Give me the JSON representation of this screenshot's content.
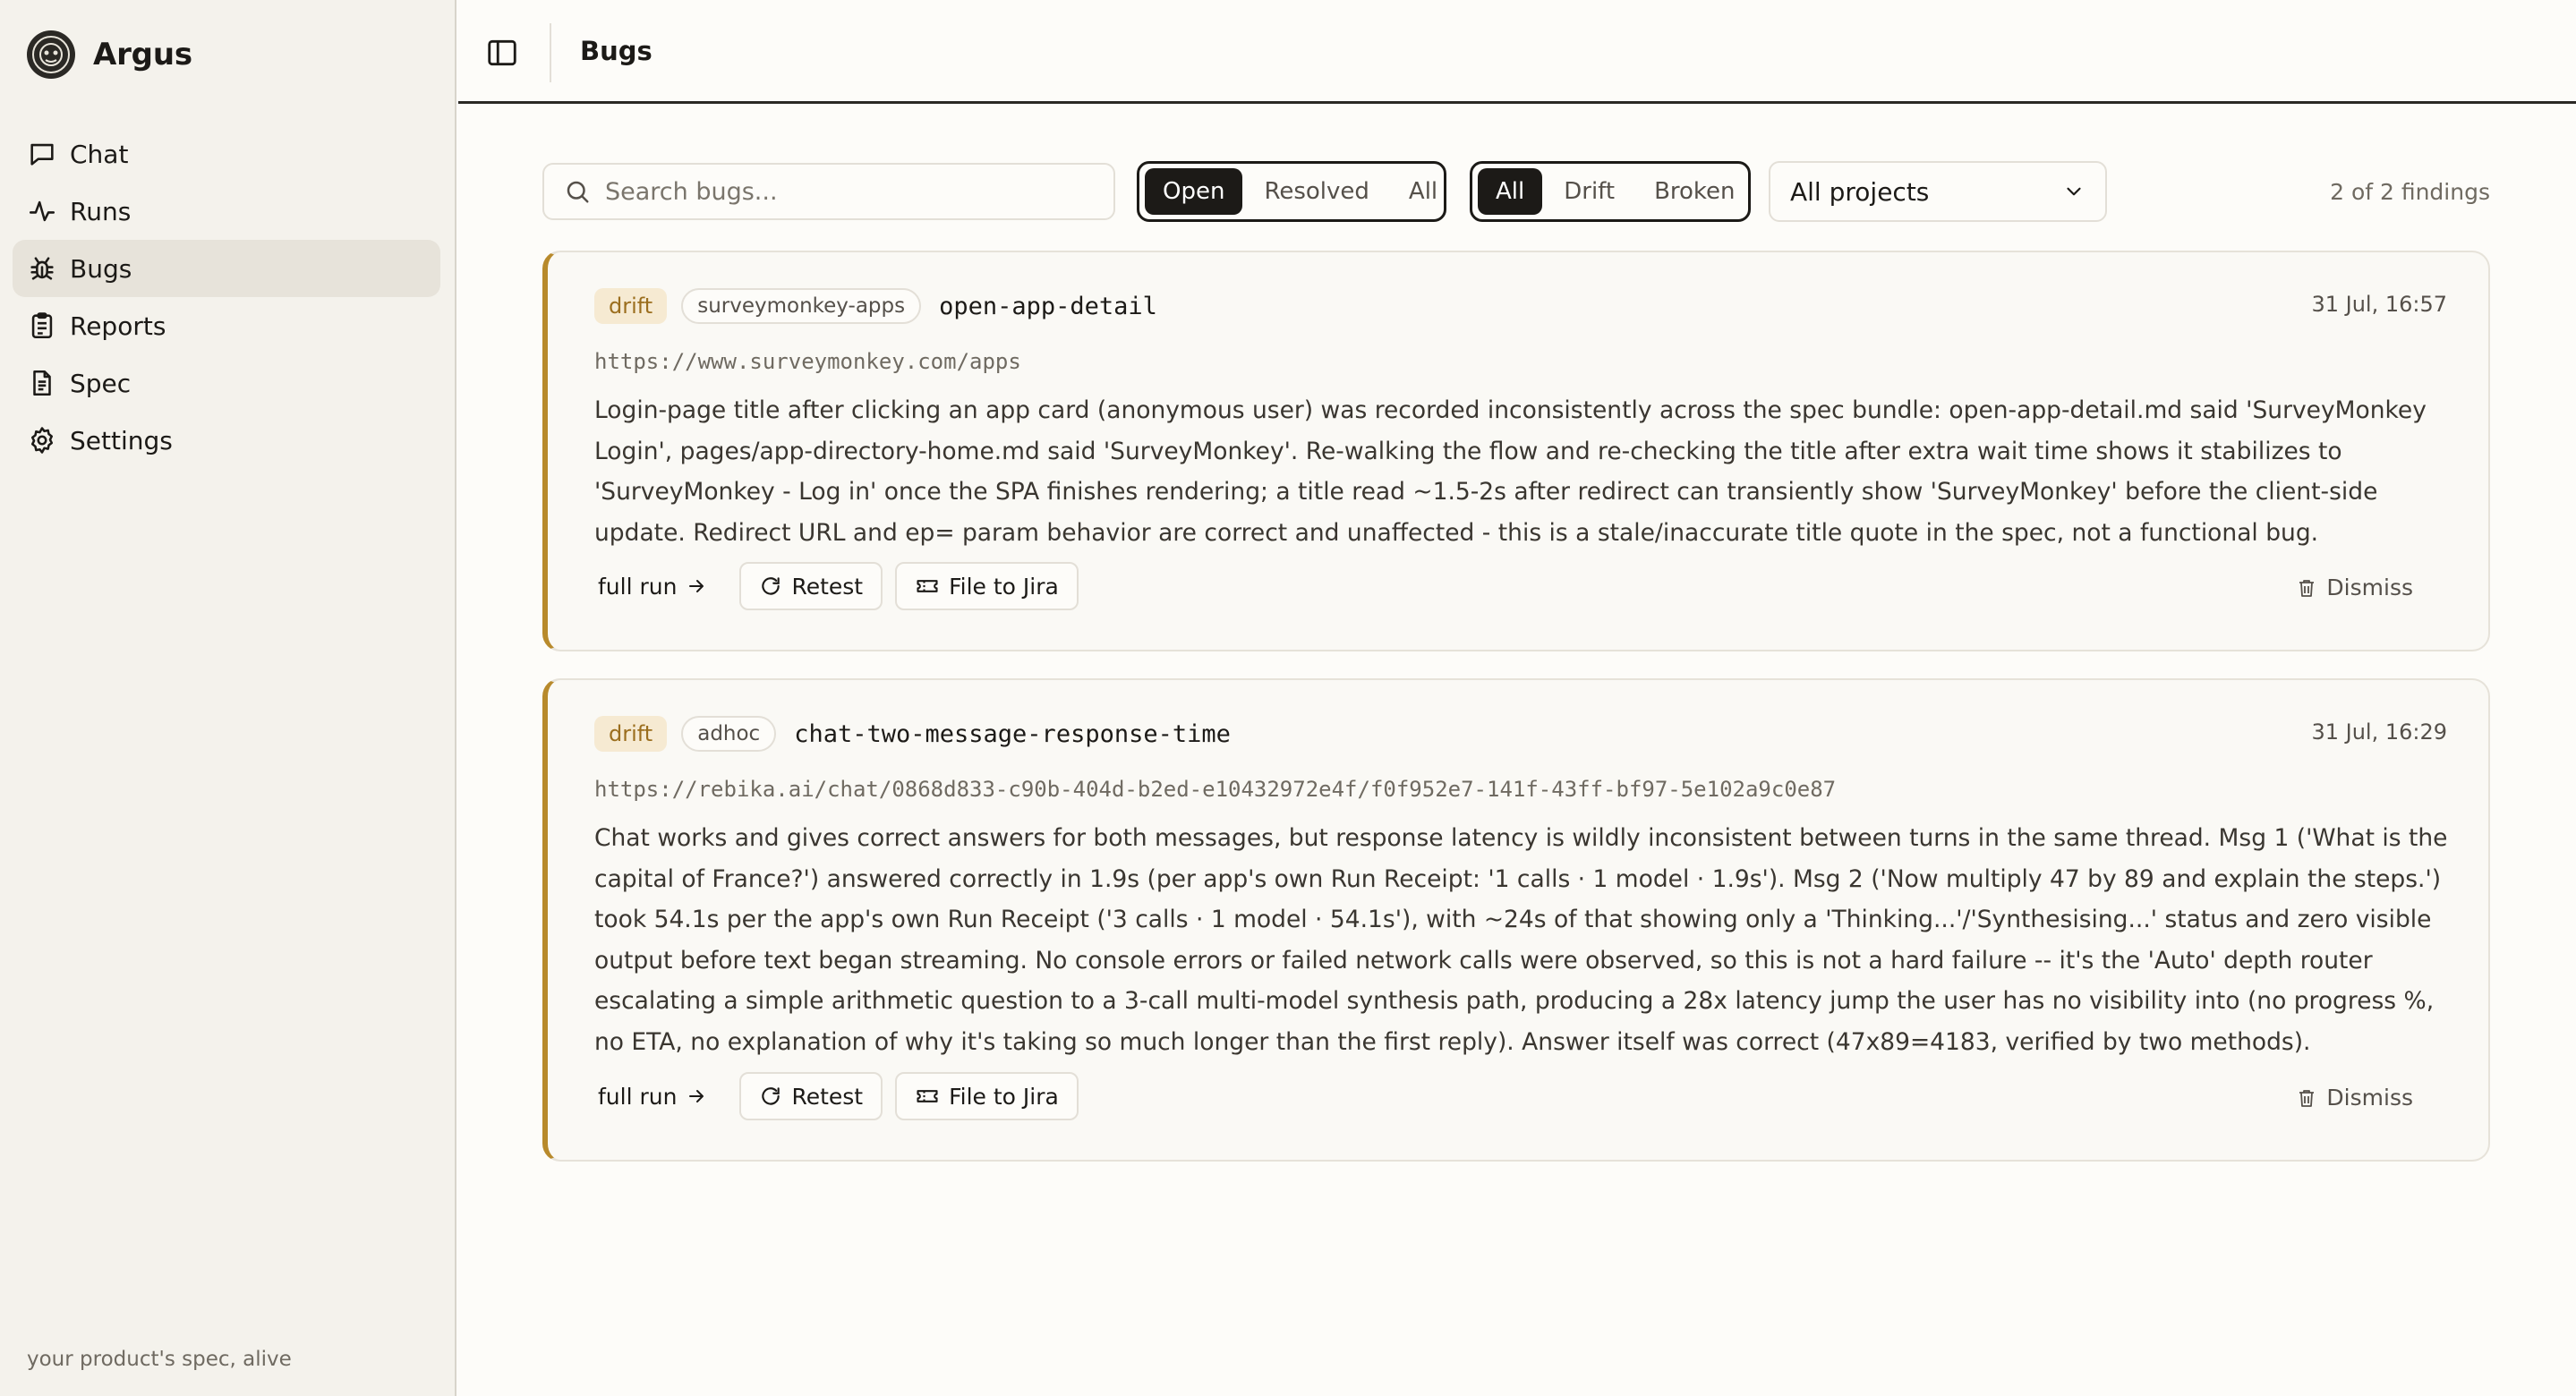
{
  "sidebar": {
    "brand": "Argus",
    "items": [
      {
        "label": "Chat",
        "icon": "message-square-icon"
      },
      {
        "label": "Runs",
        "icon": "activity-icon"
      },
      {
        "label": "Bugs",
        "icon": "bug-icon"
      },
      {
        "label": "Reports",
        "icon": "clipboard-icon"
      },
      {
        "label": "Spec",
        "icon": "file-text-icon"
      },
      {
        "label": "Settings",
        "icon": "gear-icon"
      }
    ],
    "active": "Bugs",
    "tagline": "your product's spec, alive"
  },
  "header": {
    "title": "Bugs"
  },
  "toolbar": {
    "search_placeholder": "Search bugs...",
    "status_filter": {
      "options": [
        "Open",
        "Resolved",
        "All"
      ],
      "selected": "Open"
    },
    "type_filter": {
      "options": [
        "All",
        "Drift",
        "Broken"
      ],
      "selected": "All"
    },
    "project_select": "All projects",
    "findings_count": "2 of 2 findings"
  },
  "bugs": [
    {
      "type": "drift",
      "project": "surveymonkey-apps",
      "test": "open-app-detail",
      "time": "31 Jul, 16:57",
      "url": "https://www.surveymonkey.com/apps",
      "description": "Login-page title after clicking an app card (anonymous user) was recorded inconsistently across the spec bundle: open-app-detail.md said 'SurveyMonkey Login', pages/app-directory-home.md said 'SurveyMonkey'. Re-walking the flow and re-checking the title after extra wait time shows it stabilizes to 'SurveyMonkey - Log in' once the SPA finishes rendering; a title read ~1.5-2s after redirect can transiently show 'SurveyMonkey' before the client-side update. Redirect URL and ep= param behavior are correct and unaffected - this is a stale/inaccurate title quote in the spec, not a functional bug.",
      "actions": {
        "full_run": "full run",
        "retest": "Retest",
        "jira": "File to Jira",
        "dismiss": "Dismiss"
      }
    },
    {
      "type": "drift",
      "project": "adhoc",
      "test": "chat-two-message-response-time",
      "time": "31 Jul, 16:29",
      "url": "https://rebika.ai/chat/0868d833-c90b-404d-b2ed-e10432972e4f/f0f952e7-141f-43ff-bf97-5e102a9c0e87",
      "description": "Chat works and gives correct answers for both messages, but response latency is wildly inconsistent between turns in the same thread. Msg 1 ('What is the capital of France?') answered correctly in 1.9s (per app's own Run Receipt: '1 calls · 1 model · 1.9s'). Msg 2 ('Now multiply 47 by 89 and explain the steps.') took 54.1s per the app's own Run Receipt ('3 calls · 1 model · 54.1s'), with ~24s of that showing only a 'Thinking...'/'Synthesising...' status and zero visible output before text began streaming. No console errors or failed network calls were observed, so this is not a hard failure -- it's the 'Auto' depth router escalating a simple arithmetic question to a 3-call multi-model synthesis path, producing a 28x latency jump the user has no visibility into (no progress %, no ETA, no explanation of why it's taking so much longer than the first reply). Answer itself was correct (47x89=4183, verified by two methods).",
      "actions": {
        "full_run": "full run",
        "retest": "Retest",
        "jira": "File to Jira",
        "dismiss": "Dismiss"
      }
    }
  ],
  "colors": {
    "accent": "#b88a2c",
    "badge_bg": "#f6ead2",
    "badge_text": "#9b6e1e",
    "active_bg": "#1c1a17"
  }
}
